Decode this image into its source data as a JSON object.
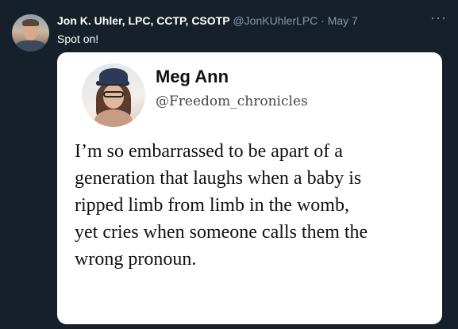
{
  "tweet": {
    "author_name": "Jon K. Uhler, LPC, CCTP, CSOTP",
    "author_handle": "@JonKUhlerLPC",
    "separator": "·",
    "date": "May 7",
    "more_icon": "···",
    "text": "Spot on!"
  },
  "embedded": {
    "name": "Meg Ann",
    "handle": "@Freedom_chronicles",
    "lines": [
      "I’m so embarrassed to be apart of a",
      "generation that laughs when a baby is",
      "ripped limb from limb in the womb,",
      "yet cries when someone calls them the",
      "wrong pronoun."
    ]
  },
  "colors": {
    "background": "#15202b",
    "secondary_text": "#8899a6",
    "card_background": "#ffffff"
  }
}
